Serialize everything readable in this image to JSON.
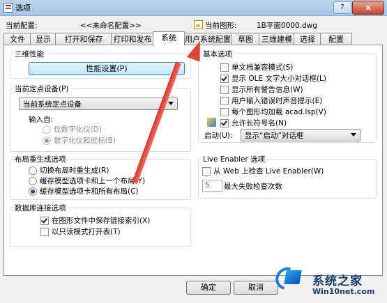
{
  "window": {
    "title": "选项",
    "help_label": "?",
    "close_label": "×"
  },
  "profile": {
    "current_label": "当前配置:",
    "current_value": "<<未命名配置>>",
    "drawing_label": "当前图形:",
    "drawing_value": "1B平面0000.dwg"
  },
  "tabs": [
    "文件",
    "显示",
    "打开和保存",
    "打印和发布",
    "系统",
    "用户系统配置",
    "草图",
    "三维建模",
    "选择",
    "配置"
  ],
  "active_tab": "系统",
  "perf": {
    "title": "三维性能",
    "button": "性能设置(P)"
  },
  "pointing": {
    "title": "当前定点设备(P)",
    "select_value": "当前系统定点设备",
    "accept_label": "输入自:",
    "options": [
      {
        "label": "仅数字化仪(D)",
        "on": false
      },
      {
        "label": "数字化仪和鼠标(B)",
        "on": true
      }
    ]
  },
  "regen": {
    "title": "布局重生成选项",
    "options": [
      {
        "label": "切换布局时重生成(R)",
        "on": false
      },
      {
        "label": "缓存模型选项卡和上一个布局(Y)",
        "on": false
      },
      {
        "label": "缓存模型选项卡和所有布局(C)",
        "on": true
      }
    ]
  },
  "db": {
    "title": "数据库连接选项",
    "options": [
      {
        "label": "在图形文件中保存链接索引(X)",
        "on": true
      },
      {
        "label": "以只读模式打开表(T)",
        "on": false
      }
    ]
  },
  "general": {
    "title": "基本选项",
    "options": [
      {
        "label": "单文档兼容模式(S)",
        "on": false
      },
      {
        "label": "显示 OLE 文字大小对话框(L)",
        "on": true
      },
      {
        "label": "显示所有警告信息(W)",
        "on": false
      },
      {
        "label": "用户输入错误时声音提示(E)",
        "on": false
      },
      {
        "label": "每个图形均加载 acad.lsp(V)",
        "on": false
      },
      {
        "label": "允许长符号名(N)",
        "on": true
      }
    ],
    "startup_label": "启动(U):",
    "startup_value": "显示“启动”对话框"
  },
  "live": {
    "title": "Live Enabler 选项",
    "check_label": "从 Web 上检查 Live Enabler(W)",
    "check_on": false,
    "max_label": "最大失败检查次数",
    "max_value": "5"
  },
  "footer": {
    "ok": "确定",
    "cancel": "取消"
  },
  "watermark": {
    "top": "系统之家",
    "bottom": "Win10net.com"
  },
  "colors": {
    "arrow": "#e0433a",
    "watermark": "#1b3a6b"
  }
}
